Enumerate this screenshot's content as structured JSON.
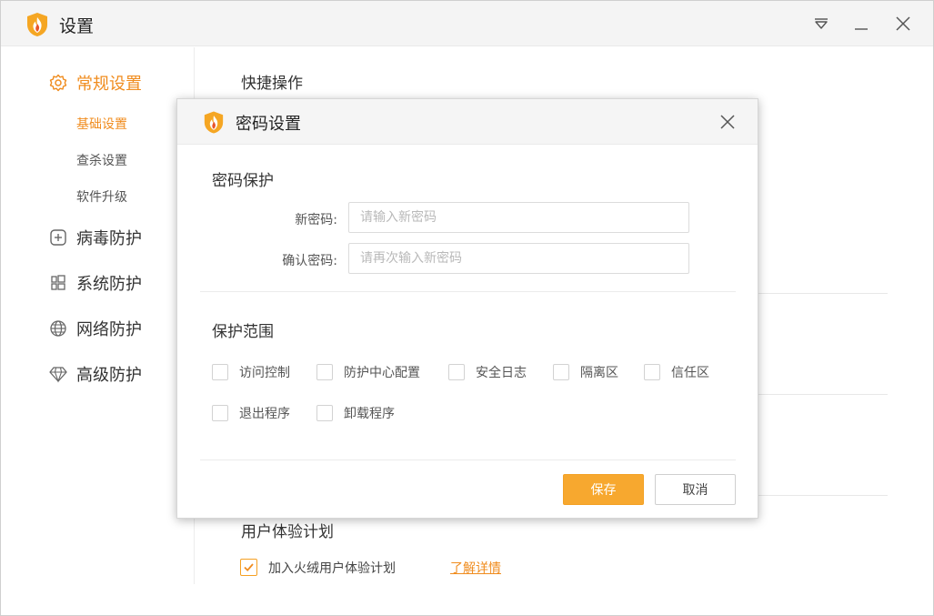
{
  "window": {
    "title": "设置"
  },
  "titlebar": {
    "menu_icon": "dropdown-triangle-icon",
    "minimize_icon": "minimize-icon",
    "close_icon": "close-icon"
  },
  "sidebar": {
    "groups": [
      {
        "label": "常规设置",
        "icon": "gear-icon",
        "active": true,
        "children": [
          {
            "label": "基础设置",
            "active": true
          },
          {
            "label": "查杀设置",
            "active": false
          },
          {
            "label": "软件升级",
            "active": false
          }
        ]
      },
      {
        "label": "病毒防护",
        "icon": "plus-square-icon",
        "active": false
      },
      {
        "label": "系统防护",
        "icon": "windows-grid-icon",
        "active": false
      },
      {
        "label": "网络防护",
        "icon": "globe-icon",
        "active": false
      },
      {
        "label": "高级防护",
        "icon": "diamond-icon",
        "active": false
      }
    ]
  },
  "background": {
    "quick_actions_title": "快捷操作",
    "ux_plan_title": "用户体验计划",
    "ux_plan_checkbox_label": "加入火绒用户体验计划",
    "ux_plan_checked": true,
    "ux_plan_link": "了解详情"
  },
  "dialog": {
    "title": "密码设置",
    "password_section_title": "密码保护",
    "new_password_label": "新密码:",
    "new_password_placeholder": "请输入新密码",
    "new_password_value": "",
    "confirm_password_label": "确认密码:",
    "confirm_password_placeholder": "请再次输入新密码",
    "confirm_password_value": "",
    "scope_section_title": "保护范围",
    "scope_options": [
      {
        "label": "访问控制",
        "checked": false
      },
      {
        "label": "防护中心配置",
        "checked": false
      },
      {
        "label": "安全日志",
        "checked": false
      },
      {
        "label": "隔离区",
        "checked": false
      },
      {
        "label": "信任区",
        "checked": false
      },
      {
        "label": "退出程序",
        "checked": false
      },
      {
        "label": "卸载程序",
        "checked": false
      }
    ],
    "save_label": "保存",
    "cancel_label": "取消"
  },
  "colors": {
    "accent": "#f08c1e",
    "primary_button": "#f7a82f",
    "flame_orange": "#f5a623",
    "flame_red": "#e8542a"
  }
}
